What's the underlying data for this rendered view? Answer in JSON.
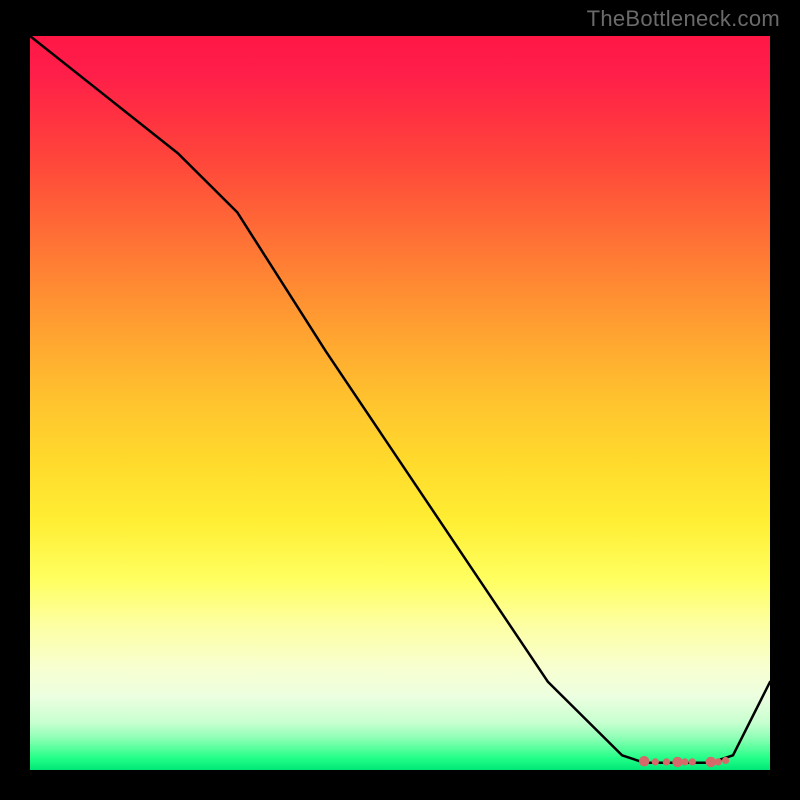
{
  "watermark": "TheBottleneck.com",
  "chart_data": {
    "type": "line",
    "title": "",
    "xlabel": "",
    "ylabel": "",
    "xlim": [
      0,
      100
    ],
    "ylim": [
      0,
      100
    ],
    "series": [
      {
        "name": "curve",
        "x": [
          0,
          10,
          20,
          28,
          40,
          50,
          60,
          70,
          80,
          83,
          86,
          89,
          92,
          95,
          100
        ],
        "y": [
          100,
          92,
          84,
          76,
          57,
          42,
          27,
          12,
          2,
          1,
          1,
          1,
          1,
          2,
          12
        ]
      }
    ],
    "markers": {
      "name": "valley-points",
      "color": "#d46a6a",
      "x": [
        83,
        84.5,
        86,
        87.5,
        88.5,
        89.5,
        92,
        93,
        94
      ],
      "y": [
        1.2,
        1.1,
        1.1,
        1.1,
        1.1,
        1.1,
        1.1,
        1.1,
        1.3
      ]
    },
    "colors": {
      "gradient_top": "#ff1745",
      "gradient_mid": "#ffd82c",
      "gradient_bottom": "#00e676",
      "background": "#000000",
      "curve": "#000000",
      "marker": "#d46a6a",
      "watermark": "#6a6a6a"
    }
  }
}
